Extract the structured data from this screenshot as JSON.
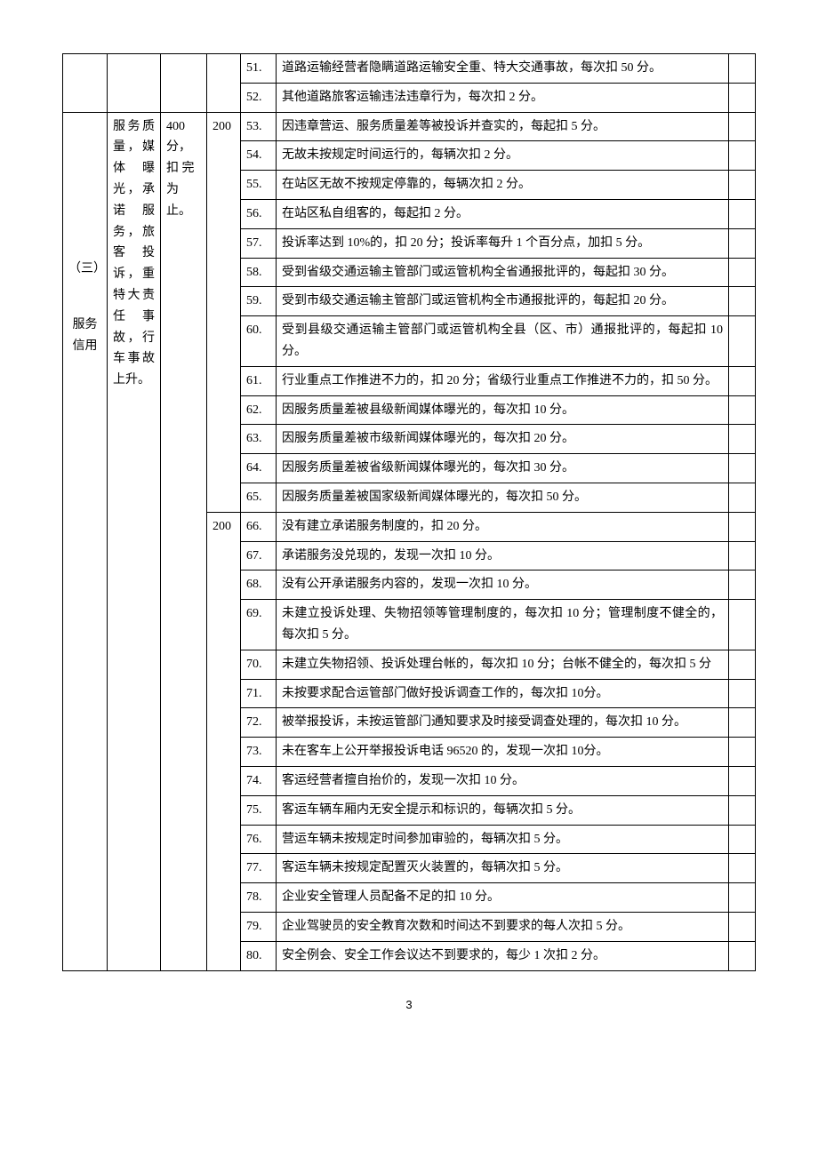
{
  "section": {
    "index": "（三）",
    "title_line1": "服务",
    "title_line2": "信用"
  },
  "desc": "服务质量，媒体曝光，承诺服务，旅客投诉，重特大责 任事故，行车事故上升。",
  "score_total": "400 分，扣 完为止。",
  "sub_score_1": "200",
  "sub_score_2": "200",
  "rows_top": [
    {
      "num": "51.",
      "text": "道路运输经营者隐瞒道路运输安全重、特大交通事故，每次扣 50 分。"
    },
    {
      "num": "52.",
      "text": "其他道路旅客运输违法违章行为，每次扣 2 分。"
    }
  ],
  "rows_group1": [
    {
      "num": "53.",
      "text": "因违章营运、服务质量差等被投诉并查实的，每起扣 5 分。"
    },
    {
      "num": "54.",
      "text": "无故未按规定时间运行的，每辆次扣 2 分。"
    },
    {
      "num": "55.",
      "text": "在站区无故不按规定停靠的，每辆次扣 2 分。"
    },
    {
      "num": "56.",
      "text": "在站区私自组客的，每起扣 2 分。"
    },
    {
      "num": "57.",
      "text": "投诉率达到 10%的，扣 20 分；投诉率每升 1 个百分点，加扣 5 分。"
    },
    {
      "num": "58.",
      "text": "受到省级交通运输主管部门或运管机构全省通报批评的，每起扣 30 分。"
    },
    {
      "num": "59.",
      "text": "受到市级交通运输主管部门或运管机构全市通报批评的，每起扣 20 分。"
    },
    {
      "num": "60.",
      "text": "受到县级交通运输主管部门或运管机构全县（区、市）通报批评的，每起扣 10 分。"
    },
    {
      "num": "61.",
      "text": "行业重点工作推进不力的，扣 20 分；省级行业重点工作推进不力的，扣 50 分。"
    },
    {
      "num": "62.",
      "text": "因服务质量差被县级新闻媒体曝光的，每次扣 10 分。"
    },
    {
      "num": "63.",
      "text": "因服务质量差被市级新闻媒体曝光的，每次扣 20 分。"
    },
    {
      "num": "64.",
      "text": "因服务质量差被省级新闻媒体曝光的，每次扣 30 分。"
    },
    {
      "num": "65.",
      "text": "因服务质量差被国家级新闻媒体曝光的，每次扣 50 分。"
    }
  ],
  "rows_group2": [
    {
      "num": "66.",
      "text": "没有建立承诺服务制度的，扣 20 分。"
    },
    {
      "num": "67.",
      "text": "承诺服务没兑现的，发现一次扣 10 分。"
    },
    {
      "num": "68.",
      "text": "没有公开承诺服务内容的，发现一次扣 10 分。"
    },
    {
      "num": "69.",
      "text": "未建立投诉处理、失物招领等管理制度的，每次扣 10 分；管理制度不健全的，每次扣 5 分。"
    },
    {
      "num": "70.",
      "text": "未建立失物招领、投诉处理台帐的，每次扣 10 分；台帐不健全的，每次扣 5 分"
    },
    {
      "num": "71.",
      "text": "未按要求配合运管部门做好投诉调查工作的，每次扣 10分。"
    },
    {
      "num": "72.",
      "text": "被举报投诉，未按运管部门通知要求及时接受调查处理的，每次扣 10 分。"
    },
    {
      "num": "73.",
      "text": "未在客车上公开举报投诉电话 96520 的，发现一次扣 10分。"
    },
    {
      "num": "74.",
      "text": "客运经营者擅自抬价的，发现一次扣 10 分。"
    },
    {
      "num": "75.",
      "text": "客运车辆车厢内无安全提示和标识的，每辆次扣 5 分。"
    },
    {
      "num": "76.",
      "text": "营运车辆未按规定时间参加审验的，每辆次扣 5 分。"
    },
    {
      "num": "77.",
      "text": "客运车辆未按规定配置灭火装置的，每辆次扣 5 分。"
    },
    {
      "num": "78.",
      "text": "企业安全管理人员配备不足的扣 10 分。"
    },
    {
      "num": "79.",
      "text": "企业驾驶员的安全教育次数和时间达不到要求的每人次扣 5 分。"
    },
    {
      "num": "80.",
      "text": "安全例会、安全工作会议达不到要求的，每少 1 次扣 2 分。"
    }
  ],
  "page_number": "3"
}
